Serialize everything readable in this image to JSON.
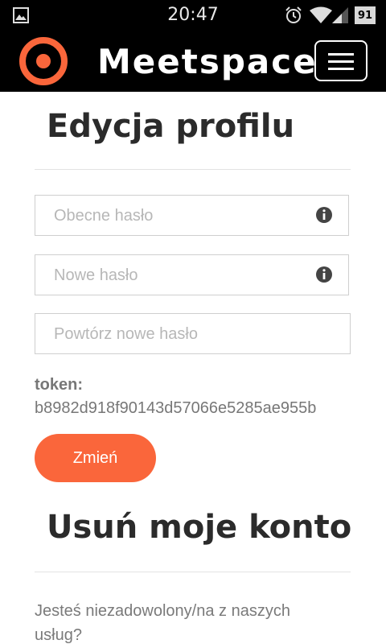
{
  "status_bar": {
    "time": "20:47",
    "battery": "91",
    "icons": [
      "image-icon",
      "alarm-icon",
      "wifi-icon",
      "signal-icon",
      "battery-icon"
    ]
  },
  "navbar": {
    "brand": "Meetspace",
    "logo_color": "#fa663b",
    "menu_icon": "hamburger-icon"
  },
  "edit_profile": {
    "title": "Edycja profilu",
    "fields": [
      {
        "placeholder": "Obecne hasło",
        "icon": "info-icon"
      },
      {
        "placeholder": "Nowe hasło",
        "icon": "info-icon"
      },
      {
        "placeholder": "Powtórz nowe hasło"
      }
    ],
    "token_label": "token:",
    "token_value": "b8982d918f90143d57066e5285ae955b",
    "submit_label": "Zmień",
    "accent_color": "#fa663b"
  },
  "delete_account": {
    "title": "Usuń moje konto",
    "text": "Jesteś niezadowolony/na z naszych usług?"
  }
}
